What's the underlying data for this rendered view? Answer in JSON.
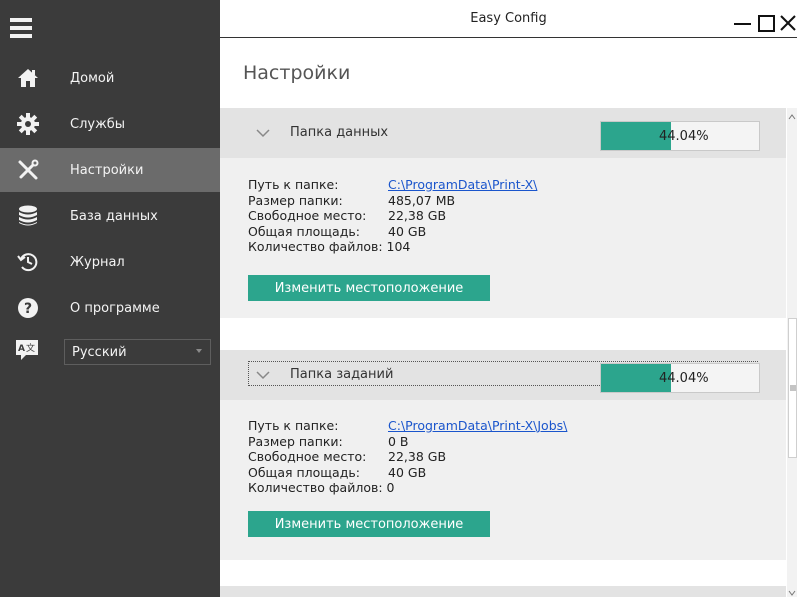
{
  "window": {
    "title": "Easy Config"
  },
  "sidebar": {
    "items": [
      {
        "label": "Домой",
        "icon": "home-icon"
      },
      {
        "label": "Службы",
        "icon": "gear-icon"
      },
      {
        "label": "Настройки",
        "icon": "tools-icon",
        "active": true
      },
      {
        "label": "База данных",
        "icon": "database-icon"
      },
      {
        "label": "Журнал",
        "icon": "history-icon"
      },
      {
        "label": "О программе",
        "icon": "help-icon"
      }
    ],
    "language": {
      "selected": "Русский",
      "icon": "language-icon"
    }
  },
  "page": {
    "title": "Настройки"
  },
  "colors": {
    "accent": "#2ca58d",
    "sidebar": "#3b3b3b",
    "active_item": "#6b6b6b",
    "link": "#1a55cc"
  },
  "sections": [
    {
      "title": "Папка данных",
      "progress_percent": 44.04,
      "progress_label": "44.04%",
      "fields": {
        "path_label": "Путь к папке:",
        "path_value": "C:\\ProgramData\\Print-X\\",
        "size_label": "Размер папки:",
        "size_value": "485,07 MB",
        "free_label": "Свободное место:",
        "free_value": "22,38 GB",
        "total_label": "Общая площадь:",
        "total_value": "40 GB",
        "count_label": "Количество файлов:",
        "count_value": "104"
      },
      "button_label": "Изменить местоположение"
    },
    {
      "title": "Папка заданий",
      "progress_percent": 44.04,
      "progress_label": "44.04%",
      "fields": {
        "path_label": "Путь к папке:",
        "path_value": "C:\\ProgramData\\Print-X\\Jobs\\",
        "size_label": "Размер папки:",
        "size_value": "0 B",
        "free_label": "Свободное место:",
        "free_value": "22,38 GB",
        "total_label": "Общая площадь:",
        "total_value": "40 GB",
        "count_label": "Количество файлов:",
        "count_value": "0"
      },
      "button_label": "Изменить местоположение"
    }
  ]
}
